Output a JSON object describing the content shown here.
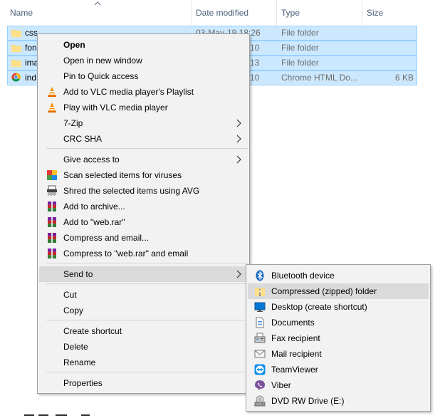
{
  "columns": {
    "name": "Name",
    "date_modified": "Date modified",
    "type": "Type",
    "size": "Size"
  },
  "files": [
    {
      "name": "css",
      "date": "03-May-19 18:26",
      "type": "File folder",
      "size": "",
      "icon": "folder-icon"
    },
    {
      "name": "fon",
      "date": "10",
      "type": "File folder",
      "size": "",
      "icon": "folder-icon"
    },
    {
      "name": "ima",
      "date": "13",
      "type": "File folder",
      "size": "",
      "icon": "folder-icon"
    },
    {
      "name": "ind",
      "date": "10",
      "type": "Chrome HTML Do...",
      "size": "6 KB",
      "icon": "chrome-icon"
    }
  ],
  "context_menu": {
    "items": [
      {
        "label": "Open",
        "bold": true
      },
      {
        "label": "Open in new window"
      },
      {
        "label": "Pin to Quick access"
      },
      {
        "label": "Add to VLC media player's Playlist",
        "icon": "vlc-icon"
      },
      {
        "label": "Play with VLC media player",
        "icon": "vlc-icon"
      },
      {
        "label": "7-Zip",
        "submenu": true
      },
      {
        "label": "CRC SHA",
        "submenu": true
      },
      {
        "label": "Give access to",
        "submenu": true
      },
      {
        "label": "Scan selected items for viruses",
        "icon": "avg-icon"
      },
      {
        "label": "Shred the selected items using AVG",
        "icon": "shredder-icon"
      },
      {
        "label": "Add to archive...",
        "icon": "winrar-icon"
      },
      {
        "label": "Add to \"web.rar\"",
        "icon": "winrar-icon"
      },
      {
        "label": "Compress and email...",
        "icon": "winrar-icon"
      },
      {
        "label": "Compress to \"web.rar\" and email",
        "icon": "winrar-icon"
      },
      {
        "label": "Send to",
        "submenu": true,
        "highlighted": true
      },
      {
        "label": "Cut"
      },
      {
        "label": "Copy"
      },
      {
        "label": "Create shortcut"
      },
      {
        "label": "Delete"
      },
      {
        "label": "Rename"
      },
      {
        "label": "Properties"
      }
    ]
  },
  "send_to_menu": {
    "items": [
      {
        "label": "Bluetooth device",
        "icon": "bluetooth-icon"
      },
      {
        "label": "Compressed (zipped) folder",
        "icon": "zip-folder-icon",
        "highlighted": true
      },
      {
        "label": "Desktop (create shortcut)",
        "icon": "desktop-icon"
      },
      {
        "label": "Documents",
        "icon": "documents-icon"
      },
      {
        "label": "Fax recipient",
        "icon": "fax-icon"
      },
      {
        "label": "Mail recipient",
        "icon": "mail-icon"
      },
      {
        "label": "TeamViewer",
        "icon": "teamviewer-icon"
      },
      {
        "label": "Viber",
        "icon": "viber-icon"
      },
      {
        "label": "DVD RW Drive (E:)",
        "icon": "dvd-drive-icon"
      }
    ]
  },
  "colors": {
    "selection_bg": "#cce8ff",
    "selection_border": "#99d1ff",
    "menu_bg": "#f2f2f2",
    "menu_highlight": "#dadada",
    "header_text": "#4c607a"
  }
}
